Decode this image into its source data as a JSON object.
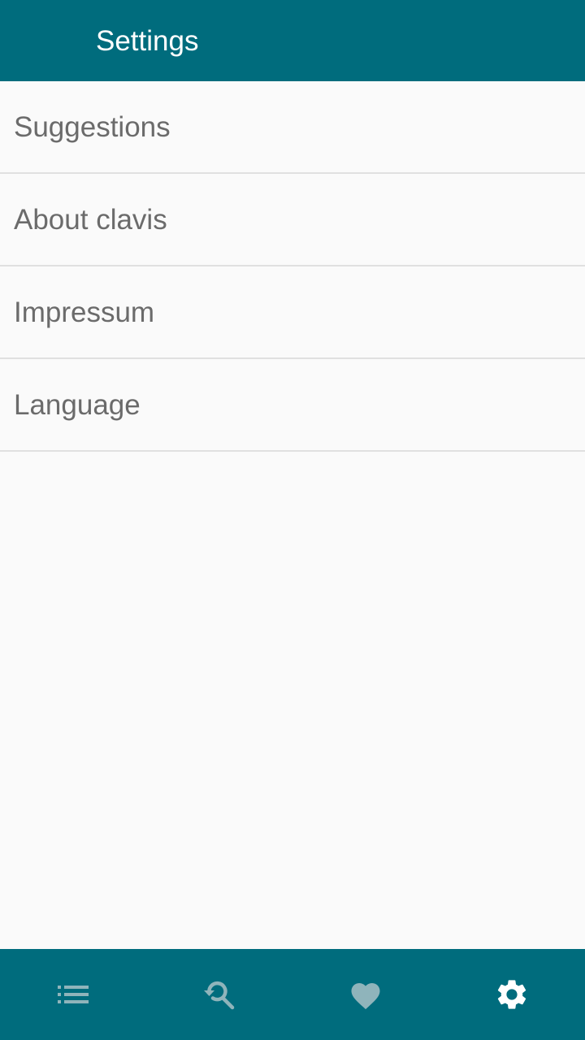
{
  "app_bar": {
    "title": "Settings"
  },
  "settings": {
    "items": [
      {
        "label": "Suggestions"
      },
      {
        "label": "About clavis"
      },
      {
        "label": "Impressum"
      },
      {
        "label": "Language"
      }
    ]
  },
  "bottom_nav": {
    "items": [
      {
        "icon": "list-icon",
        "active": false
      },
      {
        "icon": "search-history-icon",
        "active": false
      },
      {
        "icon": "heart-icon",
        "active": false
      },
      {
        "icon": "gear-icon",
        "active": true
      }
    ]
  },
  "colors": {
    "primary": "#006c7d",
    "background": "#fafafa",
    "list_text": "#6b6b6b",
    "divider": "#e0e0e0",
    "nav_icon_inactive": "#8fb4bb",
    "nav_icon_active": "#ffffff"
  }
}
